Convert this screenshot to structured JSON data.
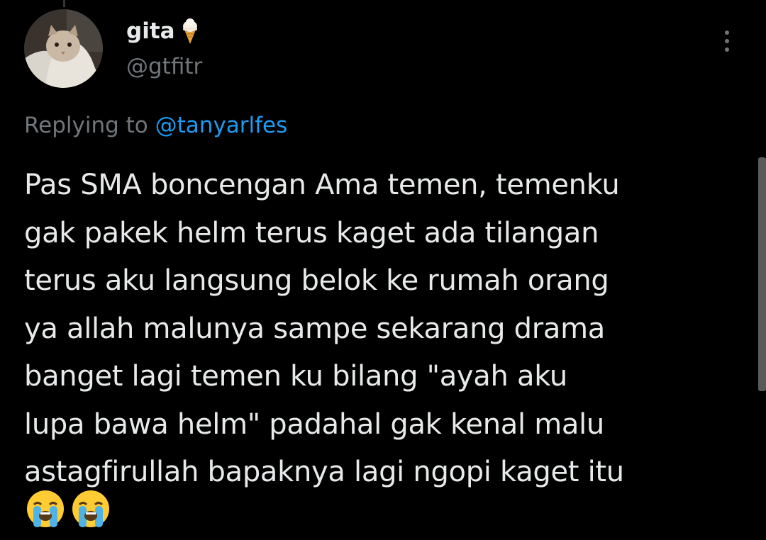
{
  "author": {
    "display_name": "gita",
    "handle": "@gtfitr",
    "badge_icon": "ice-cream-icon"
  },
  "reply_context": {
    "prefix": "Replying to",
    "mention": "@tanyarlfes"
  },
  "tweet": {
    "text": "Pas SMA boncengan Ama temen, temenku\ngak pakek helm terus kaget ada tilangan\nterus aku langsung belok ke rumah orang\nya allah malunya sampe sekarang drama\nbanget lagi temen ku bilang \"ayah aku\nlupa bawa helm\" padahal gak kenal malu\nastagfirullah bapaknya lagi ngopi kaget itu",
    "emojis": [
      "loudly-crying-face-icon",
      "loudly-crying-face-icon"
    ]
  },
  "colors": {
    "background": "#000000",
    "primary_text": "#e7e9ea",
    "secondary_text": "#71767b",
    "accent": "#1d9bf0"
  }
}
